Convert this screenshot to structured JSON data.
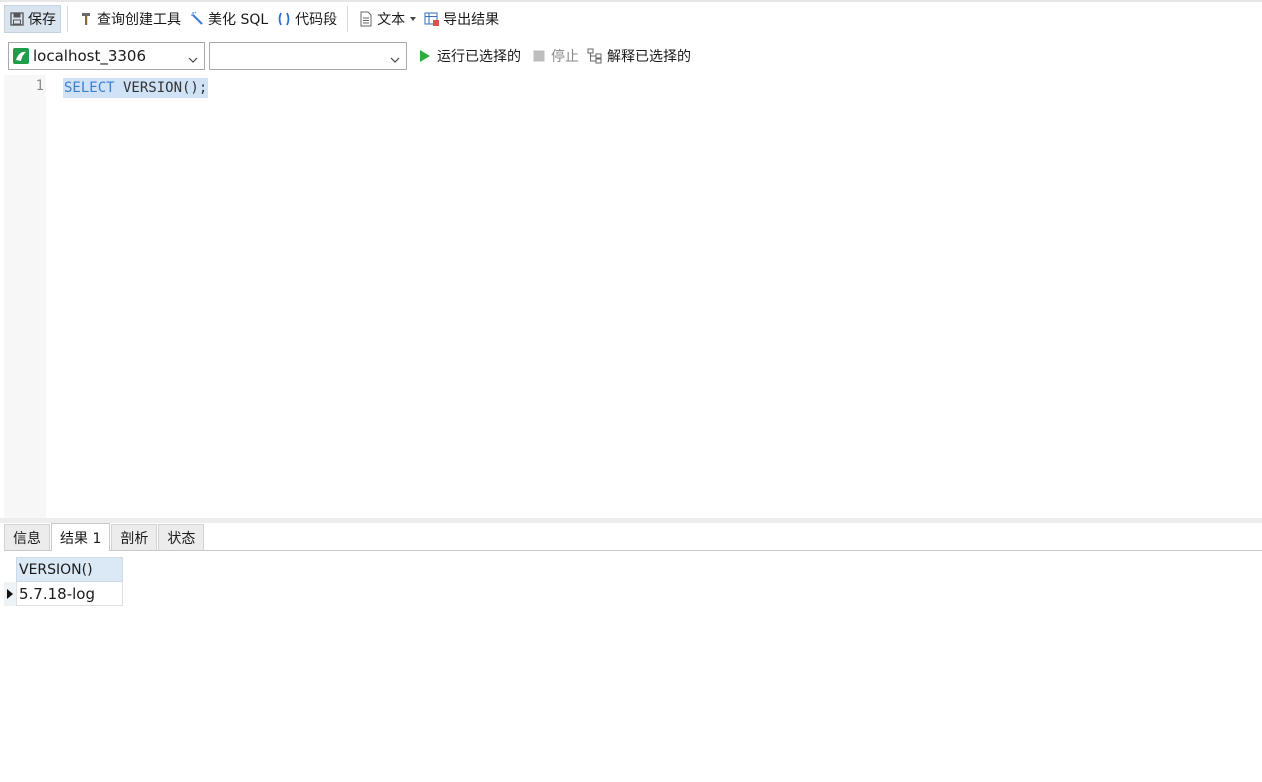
{
  "toolbar": {
    "save_label": "保存",
    "query_builder_label": "查询创建工具",
    "beautify_label": "美化 SQL",
    "snippet_label": "代码段",
    "text_label": "文本",
    "export_label": "导出结果"
  },
  "connection_bar": {
    "connection": "localhost_3306",
    "database": "",
    "run_selected_label": "运行已选择的",
    "stop_label": "停止",
    "explain_label": "解释已选择的"
  },
  "editor": {
    "line_number": "1",
    "keyword": "SELECT",
    "function_call": " VERSION();"
  },
  "result_tabs": [
    "信息",
    "结果 1",
    "剖析",
    "状态"
  ],
  "active_tab": "结果 1",
  "result_grid": {
    "column": "VERSION()",
    "rows": [
      "5.7.18-log"
    ]
  },
  "colors": {
    "keyword": "#3b7fd0",
    "selection": "#cfe2f6",
    "run_icon": "#2eae3a",
    "connection_icon": "#1f9e4a"
  },
  "icons": {
    "save": "floppy-icon",
    "query_builder": "hammer-icon",
    "beautify": "magic-wand-icon",
    "snippet": "braces-icon",
    "text": "document-icon",
    "export": "table-export-icon",
    "run": "play-icon",
    "stop": "stop-icon",
    "explain": "tree-icon"
  }
}
